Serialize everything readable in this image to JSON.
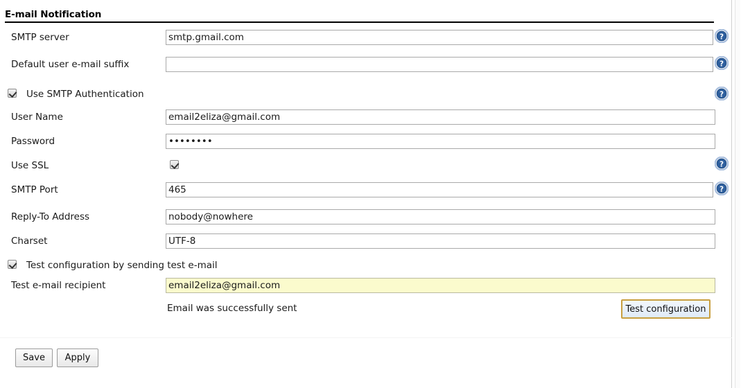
{
  "section": {
    "title": "E-mail Notification"
  },
  "fields": {
    "smtp_server": {
      "label": "SMTP server",
      "value": "smtp.gmail.com",
      "placeholder": ""
    },
    "default_suffix": {
      "label": "Default user e-mail suffix",
      "value": "",
      "placeholder": ""
    },
    "user_name": {
      "label": "User Name",
      "value": "email2eliza@gmail.com",
      "placeholder": ""
    },
    "password": {
      "label": "Password",
      "value": "••••••••",
      "placeholder": ""
    },
    "use_ssl": {
      "label": "Use SSL"
    },
    "smtp_port": {
      "label": "SMTP Port",
      "value": "465",
      "placeholder": ""
    },
    "reply_to": {
      "label": "Reply-To Address",
      "value": "nobody@nowhere",
      "placeholder": ""
    },
    "charset": {
      "label": "Charset",
      "value": "UTF-8",
      "placeholder": ""
    },
    "test_recipient": {
      "label": "Test e-mail recipient",
      "value": "email2eliza@gmail.com",
      "placeholder": ""
    }
  },
  "checkboxes": {
    "use_smtp_auth": {
      "label": "Use SMTP Authentication",
      "checked": true
    },
    "test_configuration": {
      "label": "Test configuration by sending test e-mail",
      "checked": true
    },
    "use_ssl": {
      "checked": true
    }
  },
  "status": {
    "test_result": "Email was successfully sent"
  },
  "buttons": {
    "test_configuration": "Test configuration",
    "save": "Save",
    "apply": "Apply"
  },
  "icons": {
    "help": "help-icon"
  },
  "colors": {
    "help_icon_blue": "#2e5f9e",
    "help_icon_ring": "#a8bedd",
    "autofill_yellow": "#fbfbcd",
    "test_button_border": "#c89f3f",
    "rule": "#000000"
  }
}
